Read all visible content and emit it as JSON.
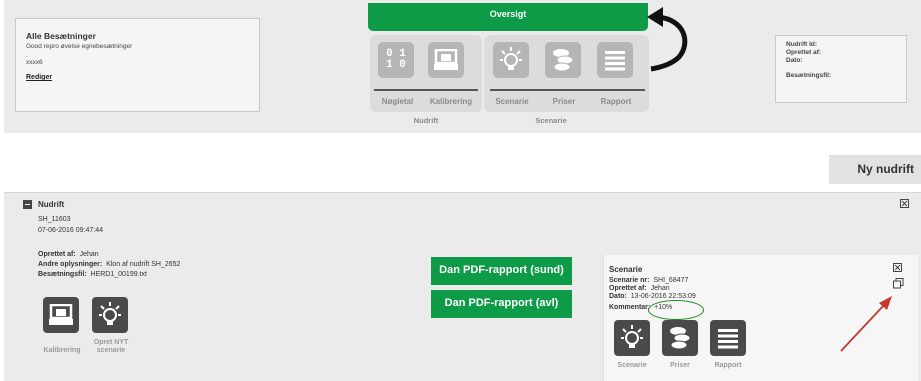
{
  "summary": {
    "title": "Alle Besætninger",
    "subtitle": "Good repro øvelse egnebesætninger",
    "dot": ".",
    "code": "xxxx6",
    "edit_link": "Rediger"
  },
  "meta": {
    "nudrift_id": "Nudrift Id:",
    "oprettet_af": "Oprettet af:",
    "dato": "Dato:",
    "besaetningsfil": "Besætningsfil:"
  },
  "nav": {
    "oversigt": "Oversigt",
    "tiles": [
      {
        "label": "Nøgletal",
        "icon": "binary-data-icon"
      },
      {
        "label": "Kalibrering",
        "icon": "monitor-tray-icon"
      },
      {
        "label": "Scenarie",
        "icon": "lightbulb-icon"
      },
      {
        "label": "Priser",
        "icon": "coins-icon"
      },
      {
        "label": "Rapport",
        "icon": "report-lines-icon"
      }
    ],
    "groups": [
      "Nudrift",
      "Scenarie"
    ],
    "binary_top": "0 1",
    "binary_bottom": "1 0"
  },
  "new_button": "Ny nudrift",
  "nudrift": {
    "heading": "Nudrift",
    "id": "SH_11603",
    "datetime": "07-06-2016 09:47:44",
    "oprettet_label": "Oprettet af:",
    "oprettet_value": "Jehan",
    "andre_label": "Andre oplysninger:",
    "andre_value": "Klon af nudrift SH_2652",
    "fil_label": "Besætningsfil:",
    "fil_value": "HERD1_00199.txt",
    "actions": [
      "Kalibrering",
      "Opret NYT scenarie"
    ]
  },
  "pdf_buttons": [
    "Dan PDF-rapport (sund)",
    "Dan PDF-rapport (avl)"
  ],
  "scenario": {
    "heading": "Scenarie",
    "nr_label": "Scenarie nr:",
    "nr_value": "SHI_68477",
    "oprettet_label": "Oprettet af:",
    "oprettet_value": "Jehan",
    "dato_label": "Dato:",
    "dato_value": "13-06-2016 22:53:09",
    "kommentar_label": "Kommentar:",
    "kommentar_value": "+10%",
    "actions": [
      "Scenarie",
      "Priser",
      "Rapport"
    ]
  },
  "colors": {
    "green": "#0e9b47",
    "tile_gray": "#b5b5b5",
    "dark_tile": "#4a4a4a",
    "annotation_red": "#c0392b"
  }
}
